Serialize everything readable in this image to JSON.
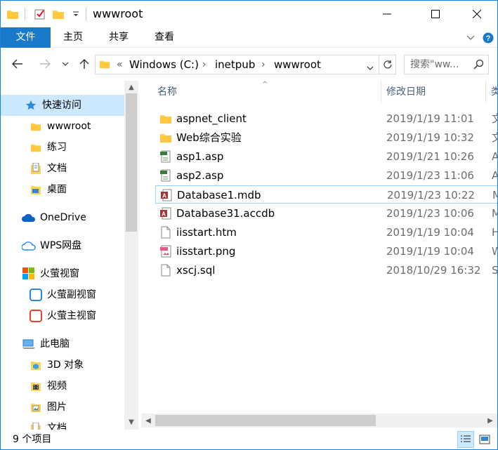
{
  "window": {
    "title": "wwwroot"
  },
  "ribbon": {
    "tabs": [
      "文件",
      "主页",
      "共享",
      "查看"
    ]
  },
  "address": {
    "overflow": "«",
    "segments": [
      "Windows (C:)",
      "inetpub",
      "wwwroot"
    ],
    "search_placeholder": "搜索\"ww..."
  },
  "sidebar": {
    "items": [
      {
        "label": "快速访问",
        "icon": "star-icon"
      },
      {
        "label": "wwwroot",
        "icon": "folder-icon"
      },
      {
        "label": "练习",
        "icon": "folder-icon"
      },
      {
        "label": "文档",
        "icon": "documents-icon"
      },
      {
        "label": "桌面",
        "icon": "desktop-icon"
      },
      {
        "label": "OneDrive",
        "icon": "onedrive-icon"
      },
      {
        "label": "WPS网盘",
        "icon": "cloud-icon"
      },
      {
        "label": "火萤视窗",
        "icon": "app-icon"
      },
      {
        "label": "火萤副视窗",
        "icon": "window-icon"
      },
      {
        "label": "火萤主视窗",
        "icon": "window-icon"
      },
      {
        "label": "此电脑",
        "icon": "computer-icon"
      },
      {
        "label": "3D 对象",
        "icon": "3d-objects-icon"
      },
      {
        "label": "视频",
        "icon": "videos-icon"
      },
      {
        "label": "图片",
        "icon": "pictures-icon"
      },
      {
        "label": "文档",
        "icon": "documents-icon"
      }
    ]
  },
  "columns": {
    "name": "名称",
    "date": "修改日期",
    "type": "类"
  },
  "files": [
    {
      "name": "aspnet_client",
      "date": "2019/1/19 11:01",
      "type": "文",
      "icon": "folder-icon"
    },
    {
      "name": "Web综合实验",
      "date": "2019/1/19 10:32",
      "type": "文",
      "icon": "folder-icon"
    },
    {
      "name": "asp1.asp",
      "date": "2019/1/21 10:26",
      "type": "A",
      "icon": "asp-file-icon"
    },
    {
      "name": "asp2.asp",
      "date": "2019/1/23 11:06",
      "type": "A",
      "icon": "asp-file-icon"
    },
    {
      "name": "Database1.mdb",
      "date": "2019/1/23 10:22",
      "type": "M",
      "icon": "access-file-icon"
    },
    {
      "name": "Database31.accdb",
      "date": "2019/1/23 10:06",
      "type": "M",
      "icon": "access-file-icon"
    },
    {
      "name": "iisstart.htm",
      "date": "2019/1/19 10:04",
      "type": "H",
      "icon": "blank-file-icon"
    },
    {
      "name": "iisstart.png",
      "date": "2019/1/19 10:04",
      "type": "W",
      "icon": "png-file-icon"
    },
    {
      "name": "xscj.sql",
      "date": "2018/10/29 16:32",
      "type": "S",
      "icon": "blank-file-icon"
    }
  ],
  "status": {
    "count": "9 个项目"
  },
  "colors": {
    "accent": "#1979ca",
    "selection": "#cce8ff",
    "folder": "#ffd35b"
  }
}
